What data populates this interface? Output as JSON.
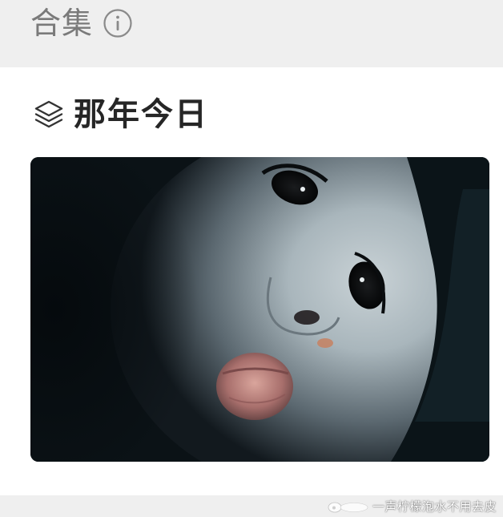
{
  "header": {
    "title": "合集",
    "info_icon": "info-circle-icon",
    "background": "#efefef",
    "title_color": "#7a7a7a"
  },
  "section": {
    "title": "那年今日",
    "icon": "layers-icon",
    "title_color": "#262626"
  },
  "photo": {
    "subject": "close-up portrait photo"
  },
  "footer": {
    "watermark_text": "一声柠檬泡水不用去皮",
    "watermark_logo": "weibo-logo-icon"
  }
}
